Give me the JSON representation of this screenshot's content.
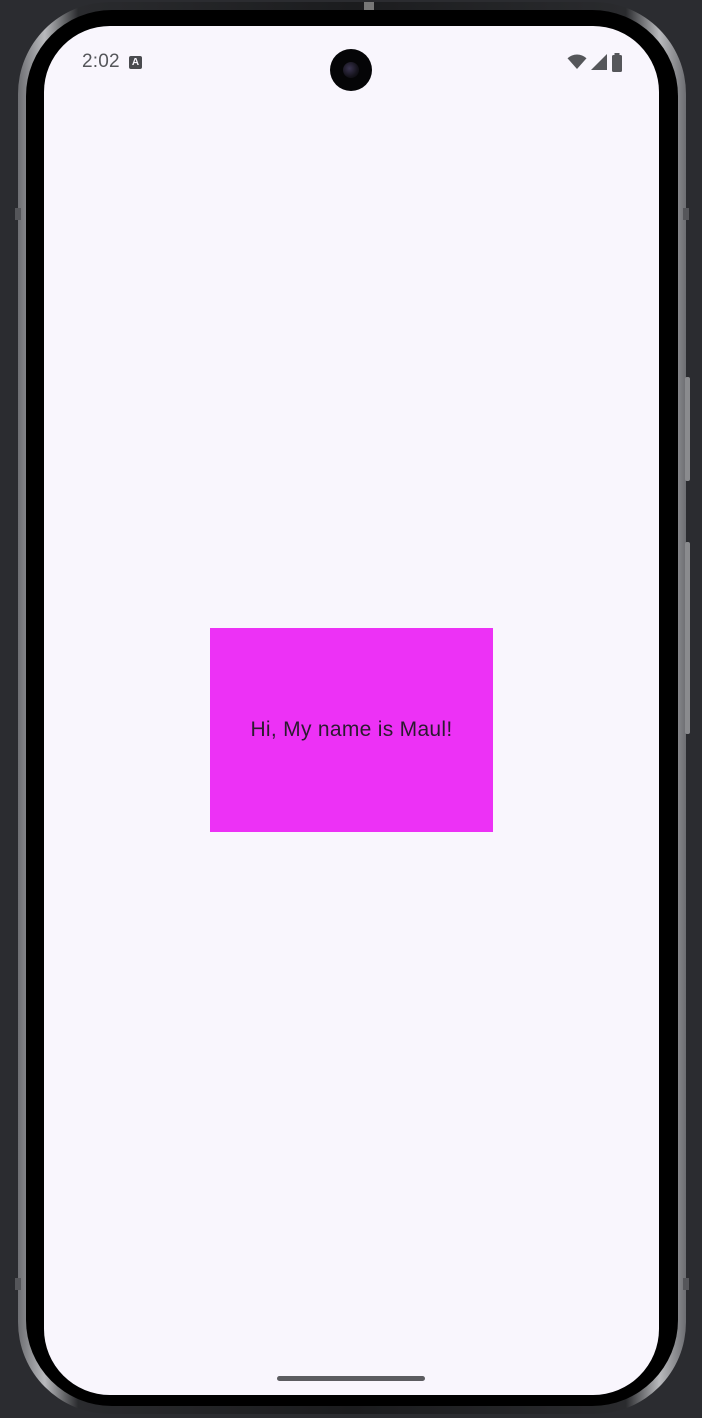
{
  "status_bar": {
    "time": "2:02",
    "notification_icon": "a-box-icon",
    "icons": [
      "wifi-icon",
      "cellular-signal-icon",
      "battery-icon"
    ]
  },
  "main": {
    "greeting": "Hi, My name is Maul!",
    "card_color": "#ed31f6"
  },
  "colors": {
    "screen_background": "#f9f6fd",
    "text": "#2a1b2e"
  }
}
